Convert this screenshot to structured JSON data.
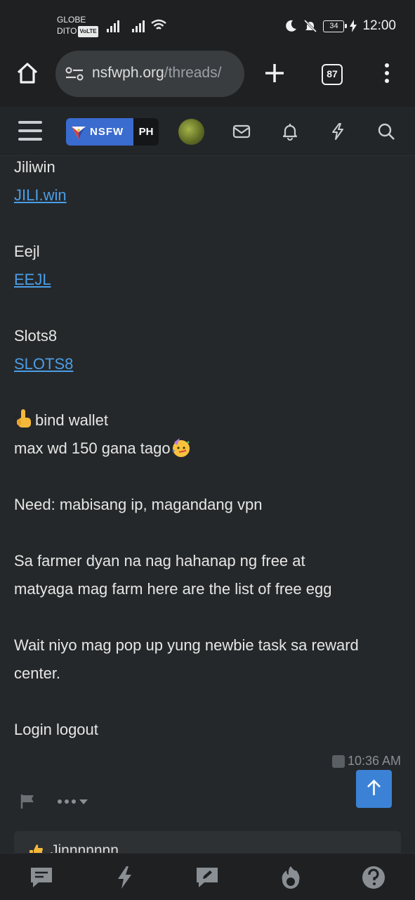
{
  "status_bar": {
    "carrier_1": "GLOBE",
    "carrier_2": "DITO",
    "volte": "VoLTE",
    "battery": "34",
    "time": "12:00"
  },
  "browser": {
    "url_host": "nsfwph.org",
    "url_path": "/threads/",
    "tab_count": "87"
  },
  "site_nav": {
    "logo_left": "NSFW",
    "logo_right": "PH"
  },
  "post": {
    "lines": [
      {
        "type": "text",
        "value": "Jiliwin"
      },
      {
        "type": "link",
        "value": "JILI.win"
      },
      {
        "type": "text",
        "value": "Eejl"
      },
      {
        "type": "link",
        "value": "EEJL"
      },
      {
        "type": "text",
        "value": "Slots8"
      },
      {
        "type": "link",
        "value": "SLOTS8"
      },
      {
        "type": "text",
        "value": "bind wallet"
      },
      {
        "type": "text",
        "value": "max wd 150 gana tago"
      },
      {
        "type": "text",
        "value": "Need: mabisang ip, magandang vpn"
      },
      {
        "type": "text",
        "value": "Sa farmer dyan na nag hahanap ng free at"
      },
      {
        "type": "text",
        "value": "matyaga mag farm here are the list of free egg"
      },
      {
        "type": "text",
        "value": "Wait niyo mag pop up yung newbie task sa reward"
      },
      {
        "type": "text",
        "value": "center."
      },
      {
        "type": "text",
        "value": "Login logout"
      }
    ],
    "timestamp": "10:36 AM"
  },
  "next_post_preview": "Jinnnnnnn",
  "colors": {
    "background": "#25282a",
    "link": "#4a9ee8",
    "accent": "#3b82d6"
  }
}
